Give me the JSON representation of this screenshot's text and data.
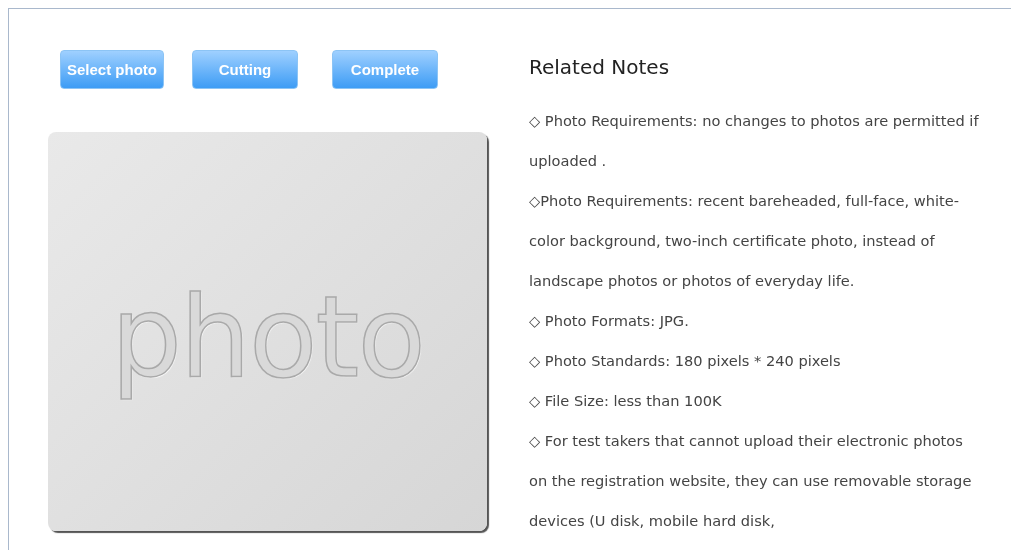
{
  "buttons": [
    {
      "label": "Select photo"
    },
    {
      "label": "Cutting"
    },
    {
      "label": "Complete"
    }
  ],
  "photo_placeholder": {
    "text": "photo"
  },
  "notes": {
    "title": "Related Notes",
    "items": [
      "◇ Photo Requirements: no changes to photos are permitted if uploaded .",
      "◇Photo Requirements: recent bareheaded, full-face, white-color background, two-inch certificate photo, instead of landscape photos or photos of everyday life.",
      "◇ Photo Formats: JPG.",
      "◇ Photo Standards: 180 pixels * 240 pixels",
      "◇ File Size: less than 100K",
      "◇ For test takers that cannot upload their electronic photos on the registration website, they can use removable storage devices (U disk, mobile hard disk,"
    ]
  }
}
